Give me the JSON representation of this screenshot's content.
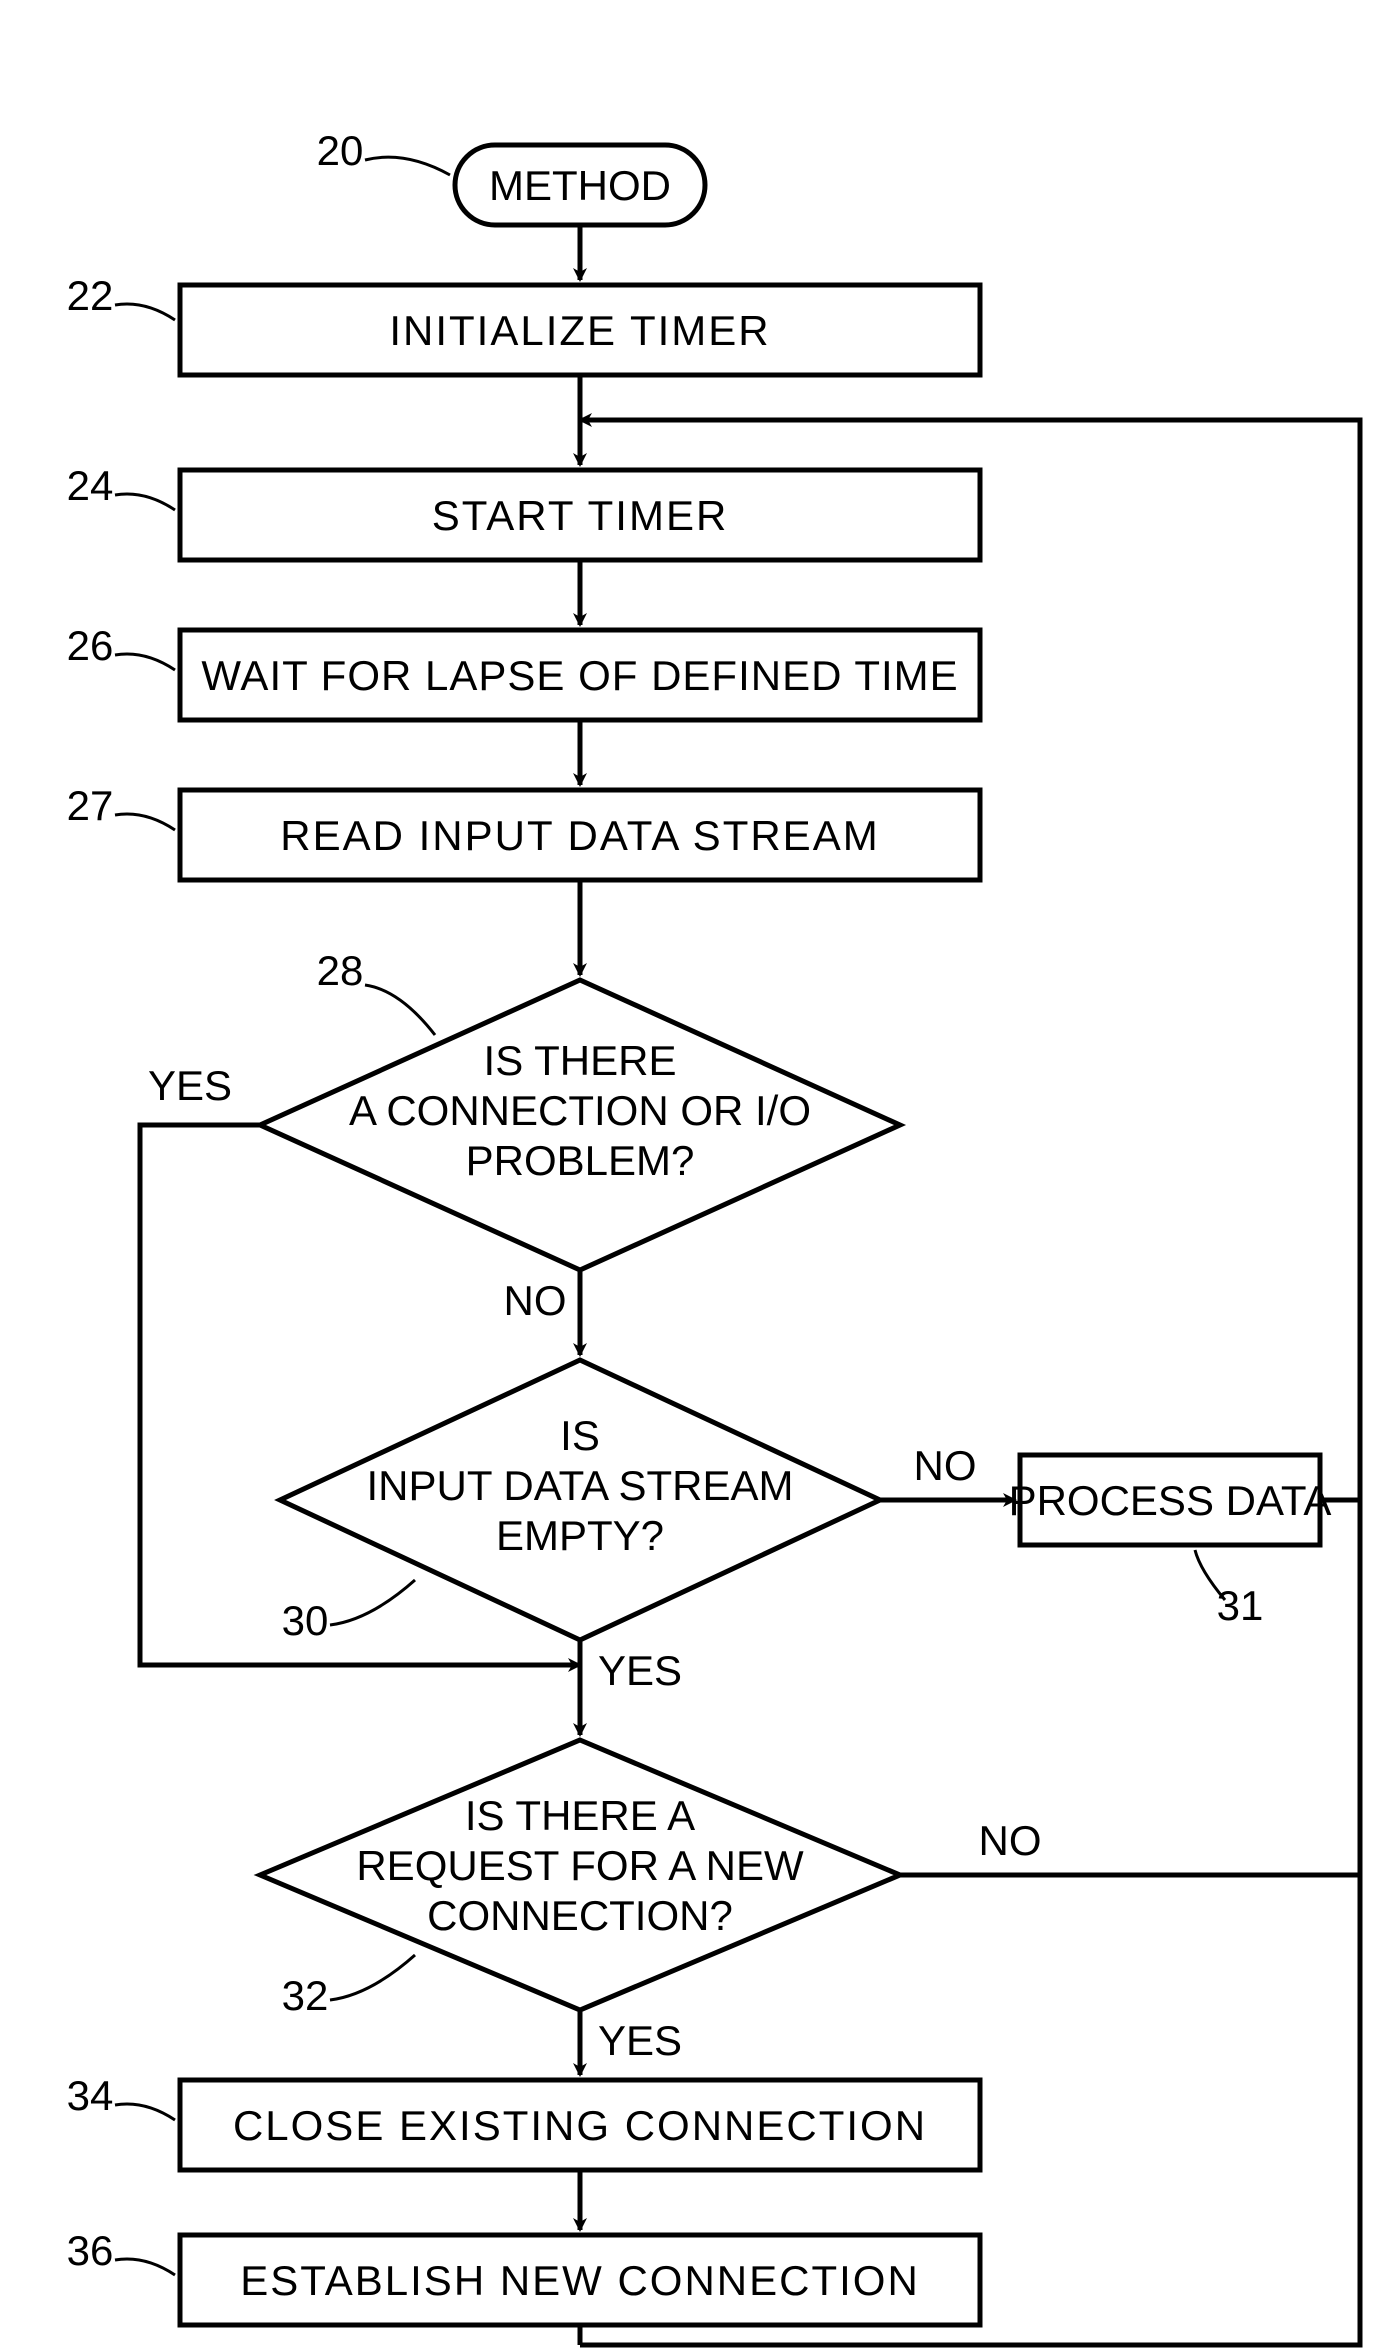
{
  "flowchart": {
    "nodes": {
      "start": {
        "label": "METHOD",
        "ref": "20"
      },
      "init": {
        "label": "INITIALIZE TIMER",
        "ref": "22"
      },
      "startTimer": {
        "label": "START TIMER",
        "ref": "24"
      },
      "wait": {
        "label": "WAIT FOR LAPSE OF DEFINED TIME",
        "ref": "26"
      },
      "read": {
        "label": "READ INPUT DATA STREAM",
        "ref": "27"
      },
      "dec1_l1": {
        "txt": "IS THERE"
      },
      "dec1_l2": {
        "txt": "A CONNECTION OR I/O"
      },
      "dec1_l3": {
        "txt": "PROBLEM?"
      },
      "dec1_ref": {
        "txt": "28"
      },
      "dec2_l1": {
        "txt": "IS"
      },
      "dec2_l2": {
        "txt": "INPUT DATA STREAM"
      },
      "dec2_l3": {
        "txt": "EMPTY?"
      },
      "dec2_ref": {
        "txt": "30"
      },
      "process": {
        "label": "PROCESS DATA",
        "ref": "31"
      },
      "dec3_l1": {
        "txt": "IS THERE A"
      },
      "dec3_l2": {
        "txt": "REQUEST FOR A NEW"
      },
      "dec3_l3": {
        "txt": "CONNECTION?"
      },
      "dec3_ref": {
        "txt": "32"
      },
      "close": {
        "label": "CLOSE EXISTING CONNECTION",
        "ref": "34"
      },
      "establish": {
        "label": "ESTABLISH NEW CONNECTION",
        "ref": "36"
      }
    },
    "edges": {
      "yes": "YES",
      "no": "NO"
    }
  }
}
